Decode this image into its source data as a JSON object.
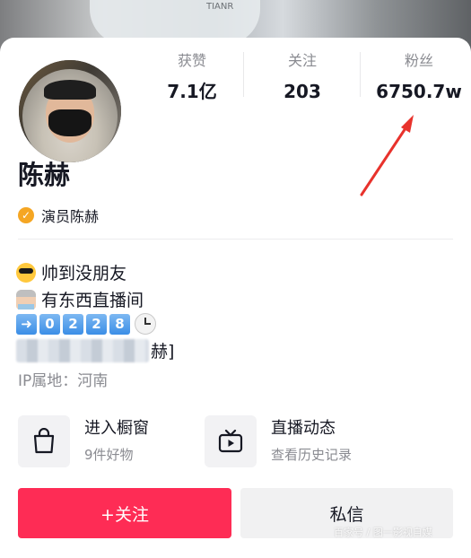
{
  "stats": [
    {
      "label": "获赞",
      "value": "7.1亿"
    },
    {
      "label": "关注",
      "value": "203"
    },
    {
      "label": "粉丝",
      "value": "6750.7w"
    }
  ],
  "profile": {
    "name": "陈赫",
    "verification": "演员陈赫",
    "ip_location": "IP属地：河南"
  },
  "bio": {
    "line1": "帅到没朋友",
    "line2": "有东西直播间",
    "keycaps": [
      "0",
      "2",
      "2",
      "8"
    ],
    "line4_suffix": "赫]"
  },
  "entries": {
    "shop": {
      "title": "进入橱窗",
      "subtitle": "9件好物",
      "icon": "shopping-bag-icon"
    },
    "live": {
      "title": "直播动态",
      "subtitle": "查看历史记录",
      "icon": "tv-icon"
    }
  },
  "buttons": {
    "follow": "+关注",
    "message": "私信"
  },
  "annotation_color": "#e8322c",
  "accent_color": "#fe2c55",
  "watermark": "百家号 / 图一影视自媒"
}
